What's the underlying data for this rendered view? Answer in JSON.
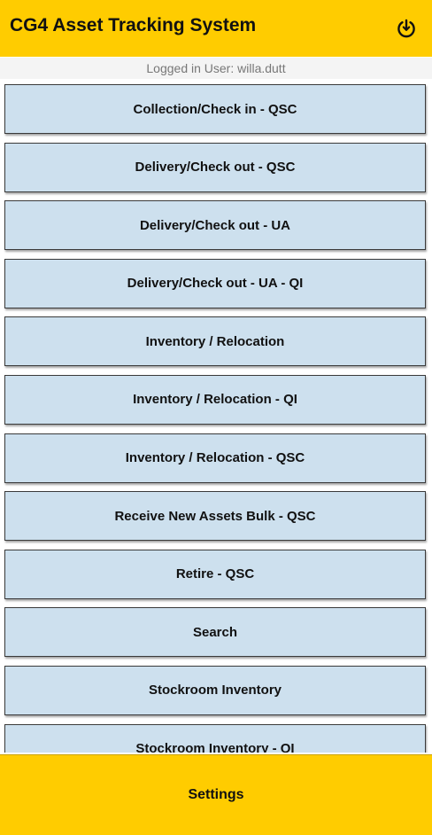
{
  "header": {
    "title": "CG4 Asset Tracking System",
    "icon": "power-download-icon",
    "background": "#ffcc00"
  },
  "user": {
    "logged_in_text": "Logged in User: willa.dutt"
  },
  "menu": {
    "button_color": "#cde0ee",
    "items": [
      "Collection/Check in - QSC",
      "Delivery/Check out - QSC",
      "Delivery/Check out - UA",
      "Delivery/Check out - UA - QI",
      "Inventory / Relocation",
      "Inventory / Relocation - QI",
      "Inventory / Relocation - QSC",
      "Receive New Assets Bulk - QSC",
      "Retire - QSC",
      "Search",
      "Stockroom Inventory",
      "Stockroom Inventory - QI"
    ]
  },
  "footer": {
    "label": "Settings"
  }
}
